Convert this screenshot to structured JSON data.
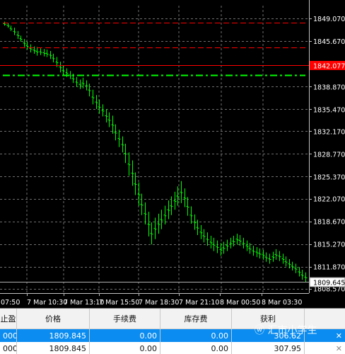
{
  "chart_data": {
    "type": "candlestick",
    "price_labels": [
      "1849.070",
      "1845.670",
      "1838.870",
      "1835.470",
      "1832.170",
      "1828.770",
      "1825.370",
      "1822.070",
      "1818.670",
      "1815.270",
      "1811.870",
      "1808.570"
    ],
    "time_labels": [
      "07:50",
      "7 Mar 10:30",
      "7 Mar 13:10",
      "7 Mar 15:50",
      "7 Mar 18:30",
      "7 Mar 21:10",
      "8 Mar 00:50",
      "8 Mar 03:30"
    ],
    "tp_lines": [
      1848.4,
      1844.7
    ],
    "sl_line": 1842.077,
    "sl_label": "1842.077",
    "entry_line": 1840.6,
    "current_price": 1809.645,
    "current_label": "1809.645",
    "ylim": [
      1807.9,
      1851.0
    ],
    "bars": [
      [
        1848.0,
        1848.6
      ],
      [
        1847.7,
        1848.4
      ],
      [
        1847.2,
        1848.0
      ],
      [
        1846.6,
        1847.7
      ],
      [
        1846.0,
        1847.2
      ],
      [
        1845.6,
        1846.5
      ],
      [
        1844.8,
        1846.0
      ],
      [
        1844.4,
        1845.6
      ],
      [
        1844.0,
        1845.2
      ],
      [
        1843.8,
        1844.9
      ],
      [
        1843.5,
        1844.8
      ],
      [
        1843.6,
        1844.6
      ],
      [
        1843.4,
        1844.5
      ],
      [
        1843.3,
        1844.4
      ],
      [
        1843.0,
        1844.2
      ],
      [
        1842.5,
        1843.8
      ],
      [
        1841.8,
        1843.3
      ],
      [
        1841.0,
        1842.6
      ],
      [
        1840.6,
        1842.0
      ],
      [
        1840.3,
        1841.6
      ],
      [
        1840.0,
        1841.2
      ],
      [
        1839.4,
        1840.8
      ],
      [
        1838.8,
        1840.3
      ],
      [
        1838.5,
        1839.9
      ],
      [
        1838.6,
        1840.2
      ],
      [
        1838.3,
        1839.8
      ],
      [
        1837.4,
        1839.3
      ],
      [
        1836.2,
        1838.4
      ],
      [
        1835.5,
        1837.6
      ],
      [
        1834.8,
        1836.9
      ],
      [
        1834.4,
        1836.2
      ],
      [
        1833.5,
        1835.5
      ],
      [
        1832.8,
        1835.0
      ],
      [
        1831.8,
        1834.5
      ],
      [
        1830.8,
        1833.2
      ],
      [
        1829.8,
        1832.4
      ],
      [
        1829.0,
        1831.4
      ],
      [
        1827.4,
        1830.3
      ],
      [
        1825.5,
        1829.0
      ],
      [
        1824.0,
        1827.8
      ],
      [
        1822.6,
        1826.0
      ],
      [
        1821.0,
        1824.5
      ],
      [
        1819.6,
        1822.8
      ],
      [
        1818.2,
        1821.5
      ],
      [
        1816.4,
        1820.1
      ],
      [
        1815.2,
        1818.5
      ],
      [
        1816.0,
        1819.2
      ],
      [
        1816.8,
        1819.8
      ],
      [
        1817.5,
        1820.4
      ],
      [
        1818.2,
        1821.0
      ],
      [
        1819.0,
        1821.8
      ],
      [
        1819.6,
        1822.4
      ],
      [
        1820.4,
        1823.1
      ],
      [
        1821.0,
        1823.9
      ],
      [
        1821.4,
        1824.7
      ],
      [
        1820.8,
        1823.6
      ],
      [
        1819.5,
        1822.3
      ],
      [
        1818.3,
        1820.9
      ],
      [
        1817.4,
        1819.7
      ],
      [
        1816.6,
        1818.9
      ],
      [
        1816.0,
        1818.1
      ],
      [
        1815.5,
        1817.5
      ],
      [
        1815.0,
        1817.0
      ],
      [
        1814.6,
        1816.5
      ],
      [
        1814.2,
        1816.2
      ],
      [
        1813.9,
        1815.8
      ],
      [
        1813.5,
        1815.4
      ],
      [
        1813.8,
        1815.6
      ],
      [
        1814.2,
        1815.9
      ],
      [
        1814.6,
        1816.2
      ],
      [
        1814.9,
        1816.5
      ],
      [
        1815.2,
        1816.8
      ],
      [
        1815.0,
        1816.6
      ],
      [
        1814.6,
        1816.2
      ],
      [
        1814.2,
        1815.8
      ],
      [
        1813.8,
        1815.4
      ],
      [
        1813.5,
        1815.0
      ],
      [
        1813.3,
        1814.8
      ],
      [
        1813.1,
        1814.6
      ],
      [
        1812.9,
        1814.4
      ],
      [
        1812.6,
        1814.0
      ],
      [
        1812.3,
        1813.8
      ],
      [
        1812.6,
        1814.1
      ],
      [
        1812.9,
        1814.5
      ],
      [
        1812.7,
        1814.2
      ],
      [
        1812.3,
        1813.8
      ],
      [
        1811.9,
        1813.4
      ],
      [
        1811.6,
        1813.0
      ],
      [
        1811.3,
        1812.6
      ],
      [
        1810.9,
        1812.3
      ],
      [
        1810.4,
        1811.8
      ],
      [
        1809.9,
        1811.4
      ],
      [
        1809.6,
        1811.0
      ]
    ]
  },
  "terminal": {
    "headers": [
      "止盈",
      "价格",
      "手续费",
      "库存费",
      "获利"
    ],
    "rows": [
      {
        "c0": "000",
        "price": "1809.845",
        "fee": "0.00",
        "swap": "0.00",
        "profit": "306.62",
        "x": "✕"
      },
      {
        "c0": "000",
        "price": "1809.845",
        "fee": "0.00",
        "swap": "0.00",
        "profit": "307.95",
        "x": "✕"
      }
    ]
  },
  "watermark": "汇市小学生",
  "colors": {
    "bg": "#000000",
    "grid": "#6f6f6f",
    "candle": "#00ff00",
    "stop_loss": "#ff0000",
    "take_profit": "#ff0000",
    "entry": "#00ff00",
    "axis_text": "#ffffff",
    "selected_row": "#0a8cf0"
  }
}
